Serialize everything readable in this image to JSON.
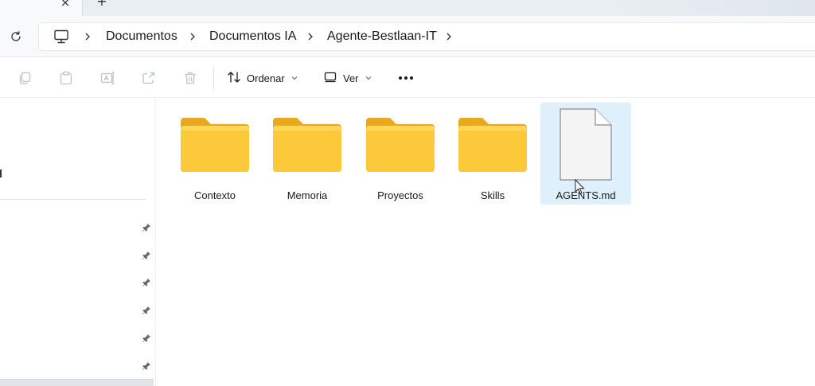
{
  "tabstrip": {
    "close_icon": "close-icon",
    "new_tab_icon": "plus-icon",
    "close_glyph": "×",
    "new_glyph": "+"
  },
  "address": {
    "refresh_icon": "refresh-icon",
    "location_icon": "this-pc-icon",
    "breadcrumbs": [
      "Documentos",
      "Documentos IA",
      "Agente-Bestlaan-IT"
    ]
  },
  "commandbar": {
    "icons": [
      "copy-icon",
      "paste-icon",
      "rename-icon",
      "share-icon",
      "delete-icon"
    ],
    "sort_label": "Ordenar",
    "view_label": "Ver",
    "more_icon": "more-options-icon"
  },
  "sidebar": {
    "pin_count": 6
  },
  "content": {
    "items": [
      {
        "name": "Contexto",
        "type": "folder",
        "selected": false
      },
      {
        "name": "Memoria",
        "type": "folder",
        "selected": false
      },
      {
        "name": "Proyectos",
        "type": "folder",
        "selected": false
      },
      {
        "name": "Skills",
        "type": "folder",
        "selected": false
      },
      {
        "name": "AGENTS.md",
        "type": "file",
        "selected": true
      }
    ]
  },
  "colors": {
    "folder_front": "#fcc93a",
    "folder_back": "#e9a91e",
    "selection": "#dff0fd",
    "accent": "#0067c0"
  }
}
